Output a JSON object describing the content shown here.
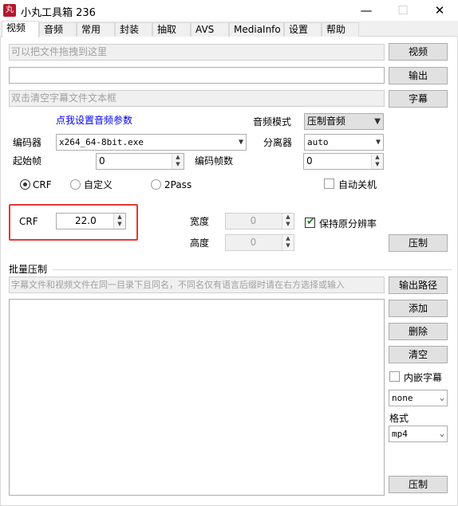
{
  "window": {
    "icon_glyph": "丸",
    "title": "小丸工具箱 236",
    "controls": {
      "minimize": "—",
      "maximize": "☐",
      "close": "✕"
    }
  },
  "tabs": [
    "视频",
    "音频",
    "常用",
    "封装",
    "抽取",
    "AVS",
    "MediaInfo",
    "设置",
    "帮助"
  ],
  "files": {
    "video_placeholder": "可以把文件拖拽到这里",
    "video_button": "视频",
    "output_value": "",
    "output_button": "输出",
    "subtitle_placeholder": "双击清空字幕文件文本框",
    "subtitle_button": "字幕"
  },
  "audio": {
    "link": "点我设置音频参数",
    "mode_label": "音频模式",
    "mode_value": "压制音频"
  },
  "encoder": {
    "label": "编码器",
    "value": "x264_64-8bit.exe",
    "splitter_label": "分离器",
    "splitter_value": "auto"
  },
  "frames": {
    "start_label": "起始帧",
    "start_value": "0",
    "count_label": "编码帧数",
    "count_value": "0"
  },
  "rate_mode": {
    "crf": "CRF",
    "custom": "自定义",
    "twopass": "2Pass",
    "selected": "CRF",
    "auto_shutdown": "自动关机"
  },
  "crf": {
    "label": "CRF",
    "value": "22.0"
  },
  "resolution": {
    "width_label": "宽度",
    "width_value": "0",
    "height_label": "高度",
    "height_value": "0",
    "keep_original": "保持原分辨率",
    "keep_original_checked": true
  },
  "encode_button": "压制",
  "batch": {
    "title": "批量压制",
    "hint": "字幕文件和视频文件在同一目录下且同名，不同名仅有语言后缀时请在右方选择或输入",
    "output_path_button": "输出路径",
    "add_button": "添加",
    "delete_button": "删除",
    "clear_button": "清空",
    "embed_subtitle": "内嵌字幕",
    "subtitle_lang_value": "none",
    "format_label": "格式",
    "format_value": "mp4",
    "encode_button": "压制"
  }
}
